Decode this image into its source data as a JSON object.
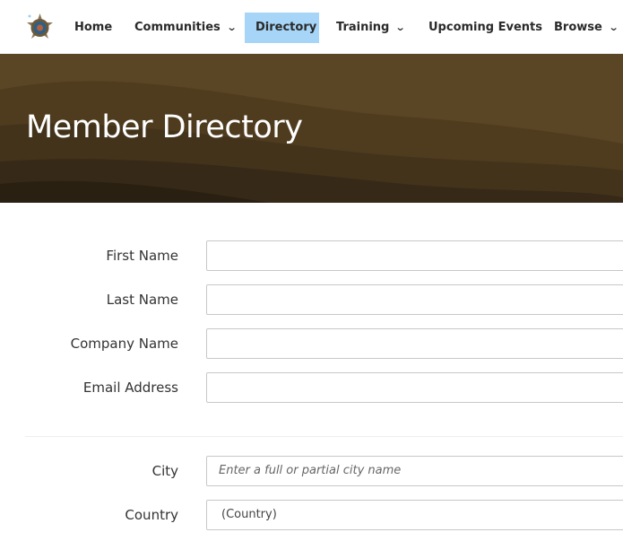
{
  "nav": {
    "items": [
      {
        "label": "Home",
        "has_dropdown": false
      },
      {
        "label": "Communities",
        "has_dropdown": true
      },
      {
        "label": "Directory",
        "has_dropdown": false,
        "active": true
      },
      {
        "label": "Training",
        "has_dropdown": true
      },
      {
        "label": "Upcoming Events",
        "has_dropdown": false
      },
      {
        "label": "Browse",
        "has_dropdown": true
      }
    ],
    "chevron": "⌄"
  },
  "banner": {
    "title": "Member Directory"
  },
  "form": {
    "first_name": {
      "label": "First Name",
      "value": ""
    },
    "last_name": {
      "label": "Last Name",
      "value": ""
    },
    "company_name": {
      "label": "Company Name",
      "value": ""
    },
    "email": {
      "label": "Email Address",
      "value": ""
    },
    "city": {
      "label": "City",
      "placeholder": "Enter a full or partial city name"
    },
    "country": {
      "label": "Country",
      "selected": "(Country)"
    }
  },
  "colors": {
    "active_nav": "#a6d5f7",
    "banner": "#5a4524"
  }
}
